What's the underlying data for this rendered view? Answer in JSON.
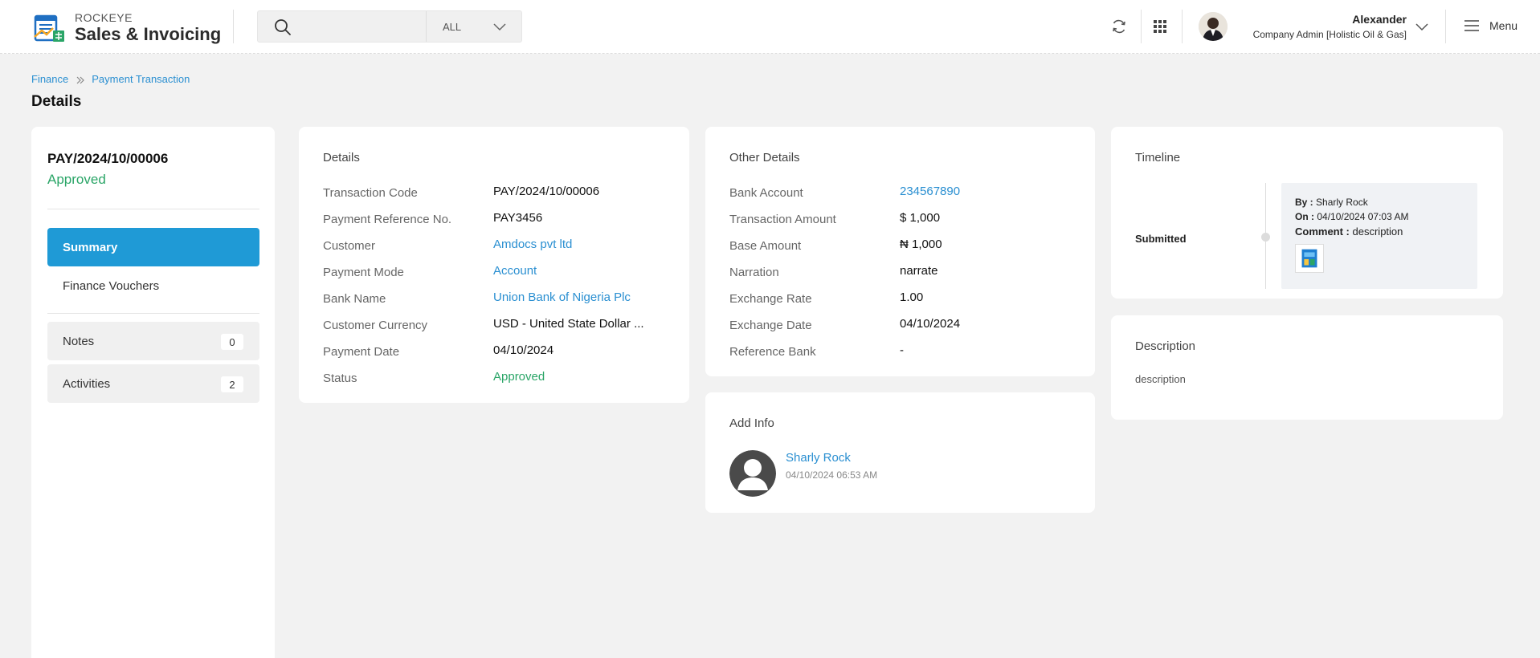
{
  "header": {
    "brand_top": "ROCKEYE",
    "brand_main": "Sales & Invoicing",
    "search_placeholder": "",
    "search_scope": "ALL",
    "user_name": "Alexander",
    "user_role": "Company Admin [Holistic Oil & Gas]",
    "menu_label": "Menu"
  },
  "breadcrumb": {
    "items": [
      "Finance",
      "Payment Transaction"
    ]
  },
  "page": {
    "title": "Details"
  },
  "left_panel": {
    "code": "PAY/2024/10/00006",
    "status": "Approved",
    "nav": [
      {
        "label": "Summary"
      },
      {
        "label": "Finance Vouchers"
      }
    ],
    "notes_label": "Notes",
    "notes_count": "0",
    "activities_label": "Activities",
    "activities_count": "2"
  },
  "details": {
    "title": "Details",
    "rows": [
      {
        "label": "Transaction Code",
        "value": "PAY/2024/10/00006"
      },
      {
        "label": "Payment Reference No.",
        "value": "PAY3456"
      },
      {
        "label": "Customer",
        "value": "Amdocs pvt ltd"
      },
      {
        "label": "Payment Mode",
        "value": "Account"
      },
      {
        "label": "Bank Name",
        "value": "Union Bank of Nigeria Plc"
      },
      {
        "label": "Customer Currency",
        "value": "USD - United State Dollar ..."
      },
      {
        "label": "Payment Date",
        "value": "04/10/2024"
      },
      {
        "label": "Status",
        "value": "Approved"
      }
    ]
  },
  "other_details": {
    "title": "Other Details",
    "rows": [
      {
        "label": "Bank Account",
        "value": "234567890"
      },
      {
        "label": "Transaction Amount",
        "value": "$ 1,000"
      },
      {
        "label": "Base Amount",
        "value": "₦ 1,000"
      },
      {
        "label": "Narration",
        "value": "narrate"
      },
      {
        "label": "Exchange Rate",
        "value": "1.00"
      },
      {
        "label": "Exchange Date",
        "value": "04/10/2024"
      },
      {
        "label": "Reference Bank",
        "value": "-"
      }
    ]
  },
  "add_info": {
    "title": "Add Info",
    "name": "Sharly Rock",
    "date": "04/10/2024 06:53 AM"
  },
  "timeline": {
    "title": "Timeline",
    "event": "Submitted",
    "by_label": "By :",
    "by_value": "Sharly Rock",
    "on_label": "On :",
    "on_value": "04/10/2024 07:03 AM",
    "comment_label": "Comment :",
    "comment_value": "description"
  },
  "description": {
    "title": "Description",
    "text": "description"
  },
  "colors": {
    "accent": "#1f9ad6",
    "link": "#2a8fd1",
    "success": "#2aa567",
    "background": "#f2f2f2"
  },
  "icons": [
    "app-logo-icon",
    "search-icon",
    "chevron-down-icon",
    "refresh-icon",
    "apps-grid-icon",
    "hamburger-icon",
    "chevron-right-icon",
    "user-placeholder-icon",
    "attachment-thumbnail-icon"
  ]
}
